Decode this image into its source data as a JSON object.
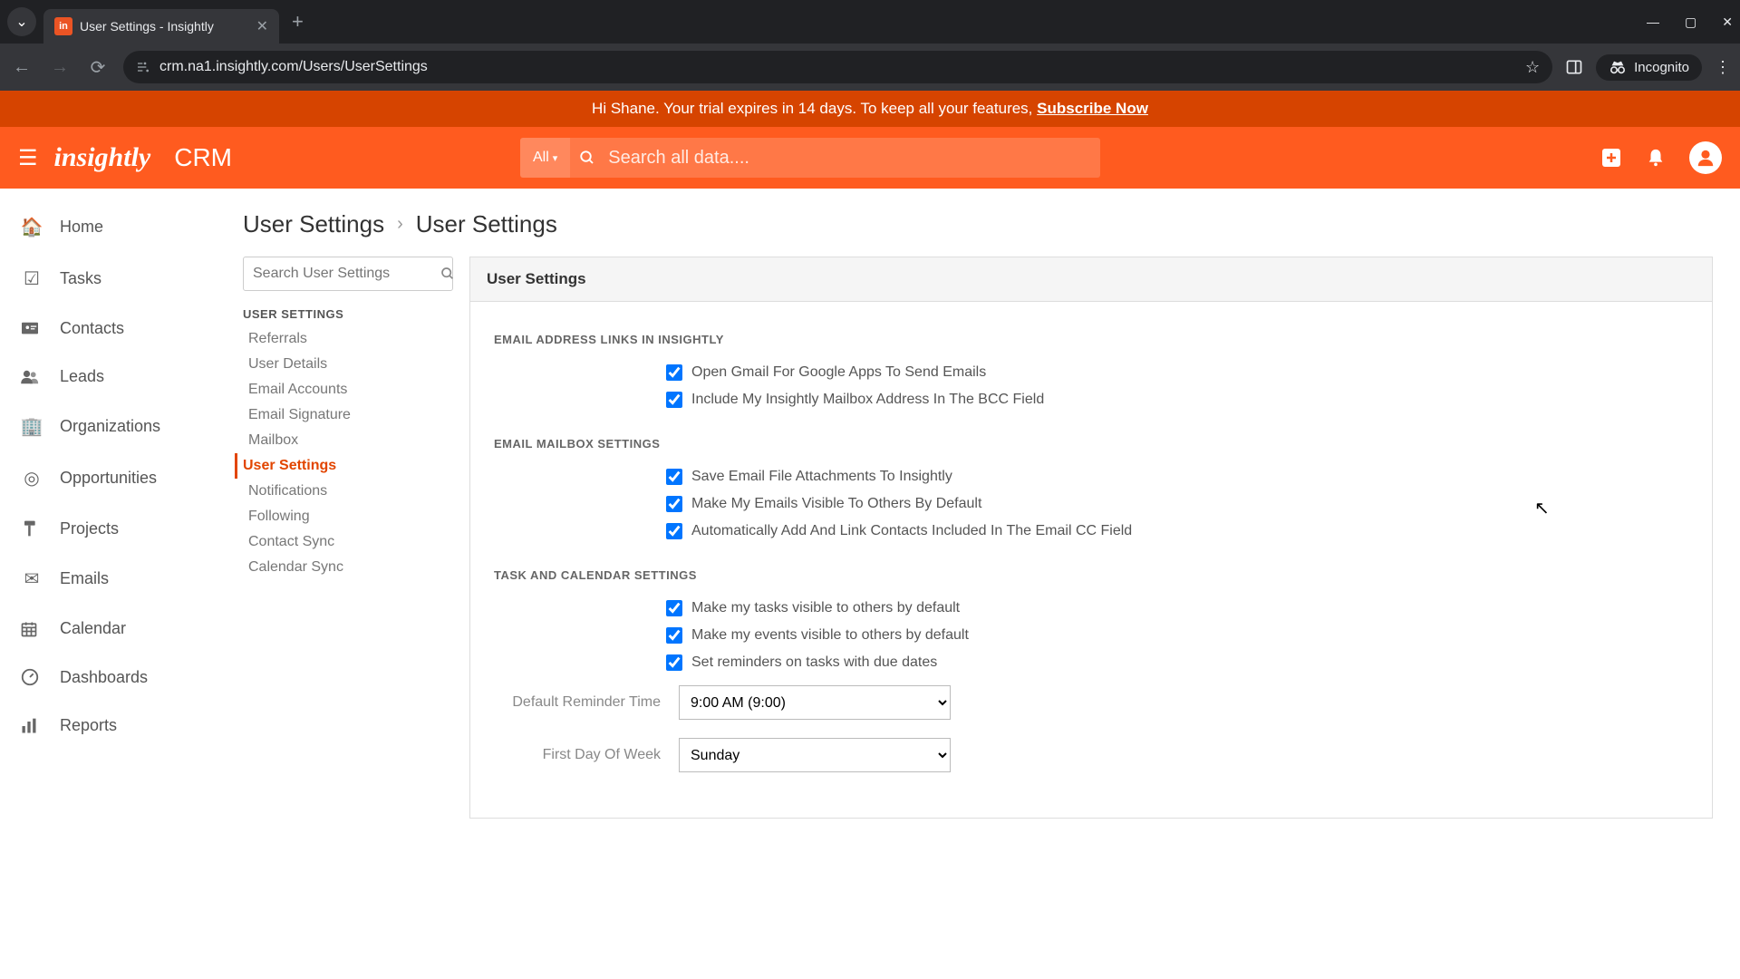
{
  "browser": {
    "tab_title": "User Settings - Insightly",
    "url": "crm.na1.insightly.com/Users/UserSettings",
    "incognito_label": "Incognito"
  },
  "banner": {
    "text_prefix": "Hi Shane. Your trial expires in 14 days. To keep all your features, ",
    "subscribe": "Subscribe Now"
  },
  "app": {
    "logo": "insightly",
    "product": "CRM",
    "search_scope": "All",
    "search_placeholder": "Search all data...."
  },
  "sidebar": {
    "items": [
      {
        "label": "Home"
      },
      {
        "label": "Tasks"
      },
      {
        "label": "Contacts"
      },
      {
        "label": "Leads"
      },
      {
        "label": "Organizations"
      },
      {
        "label": "Opportunities"
      },
      {
        "label": "Projects"
      },
      {
        "label": "Emails"
      },
      {
        "label": "Calendar"
      },
      {
        "label": "Dashboards"
      },
      {
        "label": "Reports"
      }
    ]
  },
  "breadcrumb": {
    "root": "User Settings",
    "current": "User Settings"
  },
  "settings_side": {
    "search_placeholder": "Search User Settings",
    "header": "USER SETTINGS",
    "items": [
      "Referrals",
      "User Details",
      "Email Accounts",
      "Email Signature",
      "Mailbox",
      "User Settings",
      "Notifications",
      "Following",
      "Contact Sync",
      "Calendar Sync"
    ],
    "active_index": 5
  },
  "panel": {
    "title": "User Settings",
    "sections": {
      "email_links": {
        "title": "EMAIL ADDRESS LINKS IN INSIGHTLY",
        "opts": [
          "Open Gmail For Google Apps To Send Emails",
          "Include My Insightly Mailbox Address In The BCC Field"
        ]
      },
      "mailbox": {
        "title": "EMAIL MAILBOX SETTINGS",
        "opts": [
          "Save Email File Attachments To Insightly",
          "Make My Emails Visible To Others By Default",
          "Automatically Add And Link Contacts Included In The Email CC Field"
        ]
      },
      "task_cal": {
        "title": "TASK AND CALENDAR SETTINGS",
        "opts": [
          "Make my tasks visible to others by default",
          "Make my events visible to others by default",
          "Set reminders on tasks with due dates"
        ],
        "reminder_label": "Default Reminder Time",
        "reminder_value": "9:00 AM (9:00)",
        "first_day_label": "First Day Of Week",
        "first_day_value": "Sunday"
      }
    }
  }
}
